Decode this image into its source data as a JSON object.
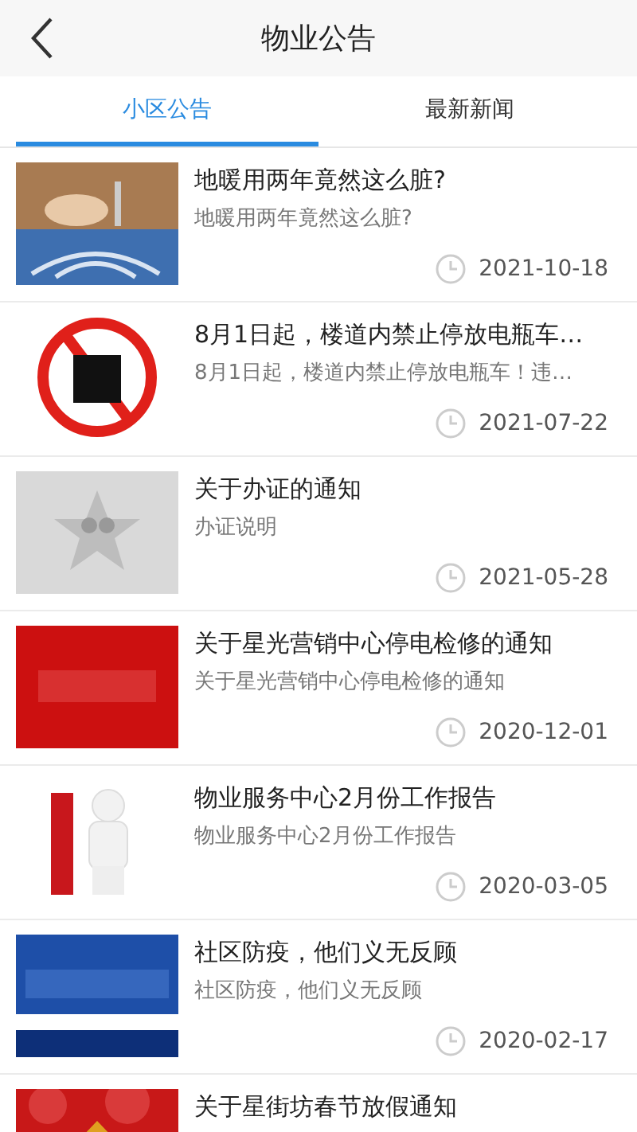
{
  "header": {
    "title": "物业公告"
  },
  "tabs": [
    {
      "label": "小区公告",
      "selected": true
    },
    {
      "label": "最新新闻",
      "selected": false
    }
  ],
  "notices": [
    {
      "title": "地暖用两年竟然这么脏?",
      "summary": "地暖用两年竟然这么脏?",
      "date": "2021-10-18"
    },
    {
      "title": "8月1日起，楼道内禁止停放电瓶车…",
      "summary": "8月1日起，楼道内禁止停放电瓶车！违…",
      "date": "2021-07-22"
    },
    {
      "title": "关于办证的通知",
      "summary": "办证说明",
      "date": "2021-05-28"
    },
    {
      "title": "关于星光营销中心停电检修的通知",
      "summary": "关于星光营销中心停电检修的通知",
      "date": "2020-12-01"
    },
    {
      "title": "物业服务中心2月份工作报告",
      "summary": "物业服务中心2月份工作报告",
      "date": "2020-03-05"
    },
    {
      "title": "社区防疫，他们义无反顾",
      "summary": "社区防疫，他们义无反顾",
      "date": "2020-02-17"
    },
    {
      "title": "关于星街坊春节放假通知"
    }
  ]
}
